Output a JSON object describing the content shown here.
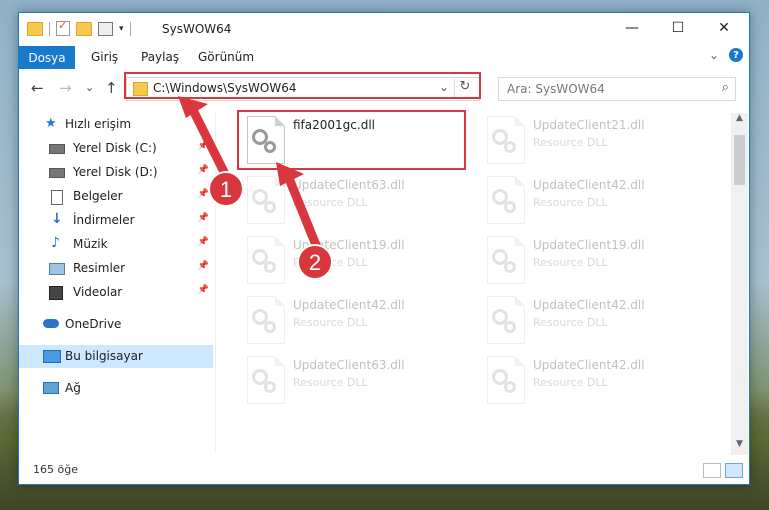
{
  "window": {
    "title": "SysWOW64",
    "controls": {
      "minimize": "—",
      "maximize": "☐",
      "close": "✕"
    }
  },
  "ribbon": {
    "tabs": [
      {
        "label": "Dosya",
        "active": true
      },
      {
        "label": "Giriş"
      },
      {
        "label": "Paylaş"
      },
      {
        "label": "Görünüm"
      }
    ],
    "expand_glyph": "⌄",
    "help_glyph": "?"
  },
  "nav": {
    "back_glyph": "←",
    "forward_glyph": "→",
    "recent_glyph": "⌄",
    "up_glyph": "↑",
    "address": "C:\\Windows\\SysWOW64",
    "address_dropdown_glyph": "⌄",
    "refresh_glyph": "↻",
    "search_placeholder": "Ara: SysWOW64",
    "search_glyph": "⌕"
  },
  "sidebar": {
    "items": [
      {
        "label": "Hızlı erişim",
        "icon": "star-icon",
        "color": "#2a74c9"
      },
      {
        "label": "Yerel Disk (C:)",
        "icon": "drive-icon",
        "pinned": true,
        "indent": true
      },
      {
        "label": "Yerel Disk (D:)",
        "icon": "drive-icon",
        "pinned": true,
        "indent": true
      },
      {
        "label": "Belgeler",
        "icon": "documents-icon",
        "pinned": true,
        "indent": true
      },
      {
        "label": "İndirmeler",
        "icon": "download-icon",
        "pinned": true,
        "indent": true
      },
      {
        "label": "Müzik",
        "icon": "music-icon",
        "pinned": true,
        "indent": true
      },
      {
        "label": "Resimler",
        "icon": "pictures-icon",
        "pinned": true,
        "indent": true
      },
      {
        "label": "Videolar",
        "icon": "videos-icon",
        "pinned": true,
        "indent": true
      },
      {
        "label": "OneDrive",
        "icon": "cloud-icon"
      },
      {
        "label": "Bu bilgisayar",
        "icon": "computer-icon",
        "selected": true
      },
      {
        "label": "Ağ",
        "icon": "network-icon"
      }
    ],
    "pin_glyph": "📌"
  },
  "files": [
    {
      "name": "fifa2001gc.dll",
      "type": "",
      "highlighted": true
    },
    {
      "name": "UpdateClient21.dll",
      "type": "Resource DLL"
    },
    {
      "name": "UpdateClient63.dll",
      "type": "Resource DLL"
    },
    {
      "name": "UpdateClient42.dll",
      "type": "Resource DLL"
    },
    {
      "name": "UpdateClient19.dll",
      "type": "Resource DLL"
    },
    {
      "name": "UpdateClient19.dll",
      "type": "Resource DLL"
    },
    {
      "name": "UpdateClient42.dll",
      "type": "Resource DLL"
    },
    {
      "name": "UpdateClient42.dll",
      "type": "Resource DLL"
    },
    {
      "name": "UpdateClient63.dll",
      "type": "Resource DLL"
    },
    {
      "name": "UpdateClient42.dll",
      "type": "Resource DLL"
    }
  ],
  "status": {
    "item_count": "165 öğe"
  },
  "annotations": {
    "step1": "1",
    "step2": "2",
    "color": "#d9363e"
  }
}
